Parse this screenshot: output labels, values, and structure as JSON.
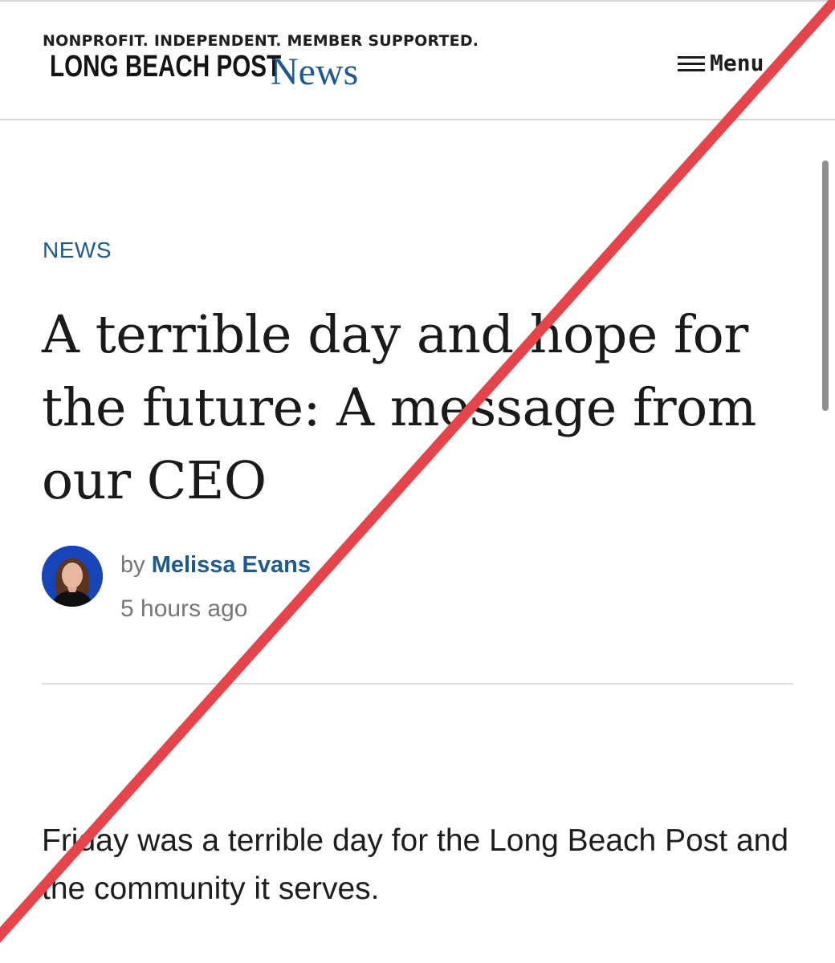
{
  "header": {
    "tagline": "NONPROFIT. INDEPENDENT. MEMBER SUPPORTED.",
    "brand": "LONG BEACH POST",
    "section": "News",
    "menu_label": "Menu"
  },
  "article": {
    "category": "NEWS",
    "title": "A terrible day and hope for the future: A message from our CEO",
    "byline_prefix": "by",
    "author": "Melissa Evans",
    "timestamp": "5 hours ago",
    "body": "Friday was a terrible day for the Long Beach Post and the community it serves."
  },
  "icons": {
    "menu": "hamburger-icon",
    "avatar": "author-photo",
    "overlay": "red-strike-line"
  },
  "colors": {
    "accent": "#1e5a8e",
    "strike": "#e5444b"
  }
}
